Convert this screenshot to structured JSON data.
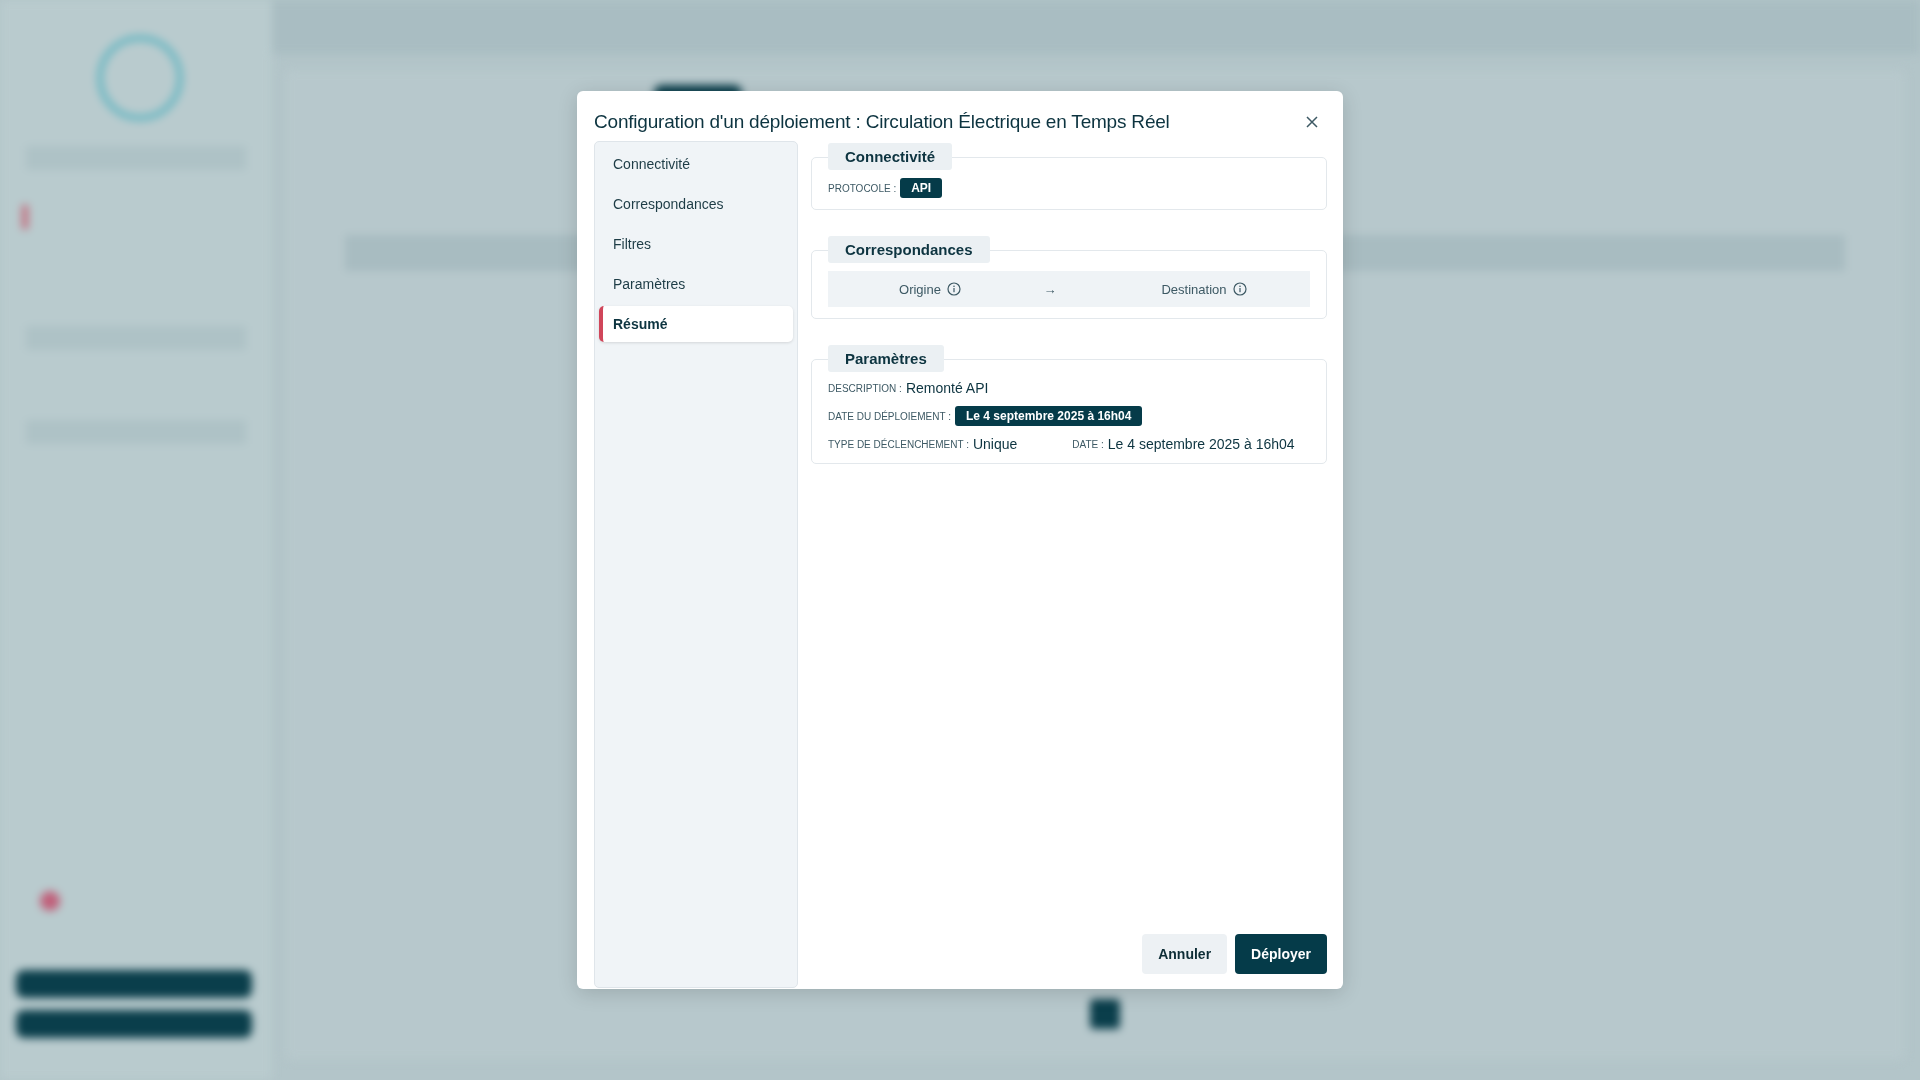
{
  "dialog": {
    "title": "Configuration d'un déploiement : Circulation Électrique en Temps Réel"
  },
  "nav": [
    {
      "label": "Connectivité",
      "selected": false
    },
    {
      "label": "Correspondances",
      "selected": false
    },
    {
      "label": "Filtres",
      "selected": false
    },
    {
      "label": "Paramètres",
      "selected": false
    },
    {
      "label": "Résumé",
      "selected": true
    }
  ],
  "sections": [
    {
      "kind": "fields",
      "title": "Connectivité",
      "rows": [
        [
          {
            "label": "PROTOCOLE :",
            "value": "API",
            "kind": "badge"
          }
        ]
      ]
    },
    {
      "kind": "mapping",
      "title": "Correspondances",
      "columns": [
        "Origine",
        "Destination"
      ],
      "arrow": "→"
    },
    {
      "kind": "fields",
      "title": "Paramètres",
      "rows": [
        [
          {
            "label": "DESCRIPTION :",
            "value": "Remonté API",
            "kind": "text"
          }
        ],
        [
          {
            "label": "DATE DU DÉPLOIEMENT :",
            "value": "Le 4 septembre 2025 à 16h04",
            "kind": "badge"
          }
        ],
        [
          {
            "label": "TYPE DE DÉCLENCHEMENT :",
            "value": "Unique",
            "kind": "text"
          },
          {
            "label": "DATE :",
            "value": "Le 4 septembre 2025 à 16h04",
            "kind": "text"
          }
        ]
      ]
    }
  ],
  "buttons": [
    {
      "label": "Annuler",
      "kind": "secondary"
    },
    {
      "label": "Déployer",
      "kind": "primary"
    }
  ]
}
